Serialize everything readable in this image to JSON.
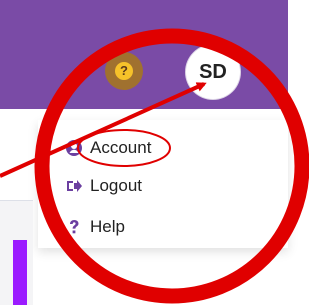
{
  "header": {
    "bg_color": "#7a4ba6"
  },
  "help_button": {
    "symbol": "?",
    "icon": "question-circle-icon"
  },
  "avatar": {
    "initials": "SD"
  },
  "menu": {
    "items": [
      {
        "label": "Account",
        "icon": "user-circle-icon"
      },
      {
        "label": "Logout",
        "icon": "sign-out-icon"
      },
      {
        "label": "Help",
        "icon": "question-icon"
      }
    ]
  },
  "annotation": {
    "circle_color": "#e00000"
  }
}
